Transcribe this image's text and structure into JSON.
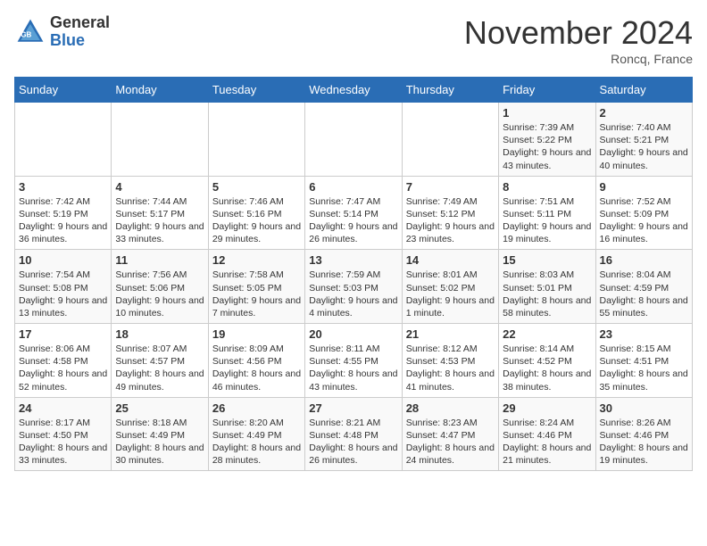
{
  "header": {
    "logo_general": "General",
    "logo_blue": "Blue",
    "month_title": "November 2024",
    "location": "Roncq, France"
  },
  "weekdays": [
    "Sunday",
    "Monday",
    "Tuesday",
    "Wednesday",
    "Thursday",
    "Friday",
    "Saturday"
  ],
  "weeks": [
    [
      {
        "day": "",
        "info": ""
      },
      {
        "day": "",
        "info": ""
      },
      {
        "day": "",
        "info": ""
      },
      {
        "day": "",
        "info": ""
      },
      {
        "day": "",
        "info": ""
      },
      {
        "day": "1",
        "info": "Sunrise: 7:39 AM\nSunset: 5:22 PM\nDaylight: 9 hours and 43 minutes."
      },
      {
        "day": "2",
        "info": "Sunrise: 7:40 AM\nSunset: 5:21 PM\nDaylight: 9 hours and 40 minutes."
      }
    ],
    [
      {
        "day": "3",
        "info": "Sunrise: 7:42 AM\nSunset: 5:19 PM\nDaylight: 9 hours and 36 minutes."
      },
      {
        "day": "4",
        "info": "Sunrise: 7:44 AM\nSunset: 5:17 PM\nDaylight: 9 hours and 33 minutes."
      },
      {
        "day": "5",
        "info": "Sunrise: 7:46 AM\nSunset: 5:16 PM\nDaylight: 9 hours and 29 minutes."
      },
      {
        "day": "6",
        "info": "Sunrise: 7:47 AM\nSunset: 5:14 PM\nDaylight: 9 hours and 26 minutes."
      },
      {
        "day": "7",
        "info": "Sunrise: 7:49 AM\nSunset: 5:12 PM\nDaylight: 9 hours and 23 minutes."
      },
      {
        "day": "8",
        "info": "Sunrise: 7:51 AM\nSunset: 5:11 PM\nDaylight: 9 hours and 19 minutes."
      },
      {
        "day": "9",
        "info": "Sunrise: 7:52 AM\nSunset: 5:09 PM\nDaylight: 9 hours and 16 minutes."
      }
    ],
    [
      {
        "day": "10",
        "info": "Sunrise: 7:54 AM\nSunset: 5:08 PM\nDaylight: 9 hours and 13 minutes."
      },
      {
        "day": "11",
        "info": "Sunrise: 7:56 AM\nSunset: 5:06 PM\nDaylight: 9 hours and 10 minutes."
      },
      {
        "day": "12",
        "info": "Sunrise: 7:58 AM\nSunset: 5:05 PM\nDaylight: 9 hours and 7 minutes."
      },
      {
        "day": "13",
        "info": "Sunrise: 7:59 AM\nSunset: 5:03 PM\nDaylight: 9 hours and 4 minutes."
      },
      {
        "day": "14",
        "info": "Sunrise: 8:01 AM\nSunset: 5:02 PM\nDaylight: 9 hours and 1 minute."
      },
      {
        "day": "15",
        "info": "Sunrise: 8:03 AM\nSunset: 5:01 PM\nDaylight: 8 hours and 58 minutes."
      },
      {
        "day": "16",
        "info": "Sunrise: 8:04 AM\nSunset: 4:59 PM\nDaylight: 8 hours and 55 minutes."
      }
    ],
    [
      {
        "day": "17",
        "info": "Sunrise: 8:06 AM\nSunset: 4:58 PM\nDaylight: 8 hours and 52 minutes."
      },
      {
        "day": "18",
        "info": "Sunrise: 8:07 AM\nSunset: 4:57 PM\nDaylight: 8 hours and 49 minutes."
      },
      {
        "day": "19",
        "info": "Sunrise: 8:09 AM\nSunset: 4:56 PM\nDaylight: 8 hours and 46 minutes."
      },
      {
        "day": "20",
        "info": "Sunrise: 8:11 AM\nSunset: 4:55 PM\nDaylight: 8 hours and 43 minutes."
      },
      {
        "day": "21",
        "info": "Sunrise: 8:12 AM\nSunset: 4:53 PM\nDaylight: 8 hours and 41 minutes."
      },
      {
        "day": "22",
        "info": "Sunrise: 8:14 AM\nSunset: 4:52 PM\nDaylight: 8 hours and 38 minutes."
      },
      {
        "day": "23",
        "info": "Sunrise: 8:15 AM\nSunset: 4:51 PM\nDaylight: 8 hours and 35 minutes."
      }
    ],
    [
      {
        "day": "24",
        "info": "Sunrise: 8:17 AM\nSunset: 4:50 PM\nDaylight: 8 hours and 33 minutes."
      },
      {
        "day": "25",
        "info": "Sunrise: 8:18 AM\nSunset: 4:49 PM\nDaylight: 8 hours and 30 minutes."
      },
      {
        "day": "26",
        "info": "Sunrise: 8:20 AM\nSunset: 4:49 PM\nDaylight: 8 hours and 28 minutes."
      },
      {
        "day": "27",
        "info": "Sunrise: 8:21 AM\nSunset: 4:48 PM\nDaylight: 8 hours and 26 minutes."
      },
      {
        "day": "28",
        "info": "Sunrise: 8:23 AM\nSunset: 4:47 PM\nDaylight: 8 hours and 24 minutes."
      },
      {
        "day": "29",
        "info": "Sunrise: 8:24 AM\nSunset: 4:46 PM\nDaylight: 8 hours and 21 minutes."
      },
      {
        "day": "30",
        "info": "Sunrise: 8:26 AM\nSunset: 4:46 PM\nDaylight: 8 hours and 19 minutes."
      }
    ]
  ]
}
